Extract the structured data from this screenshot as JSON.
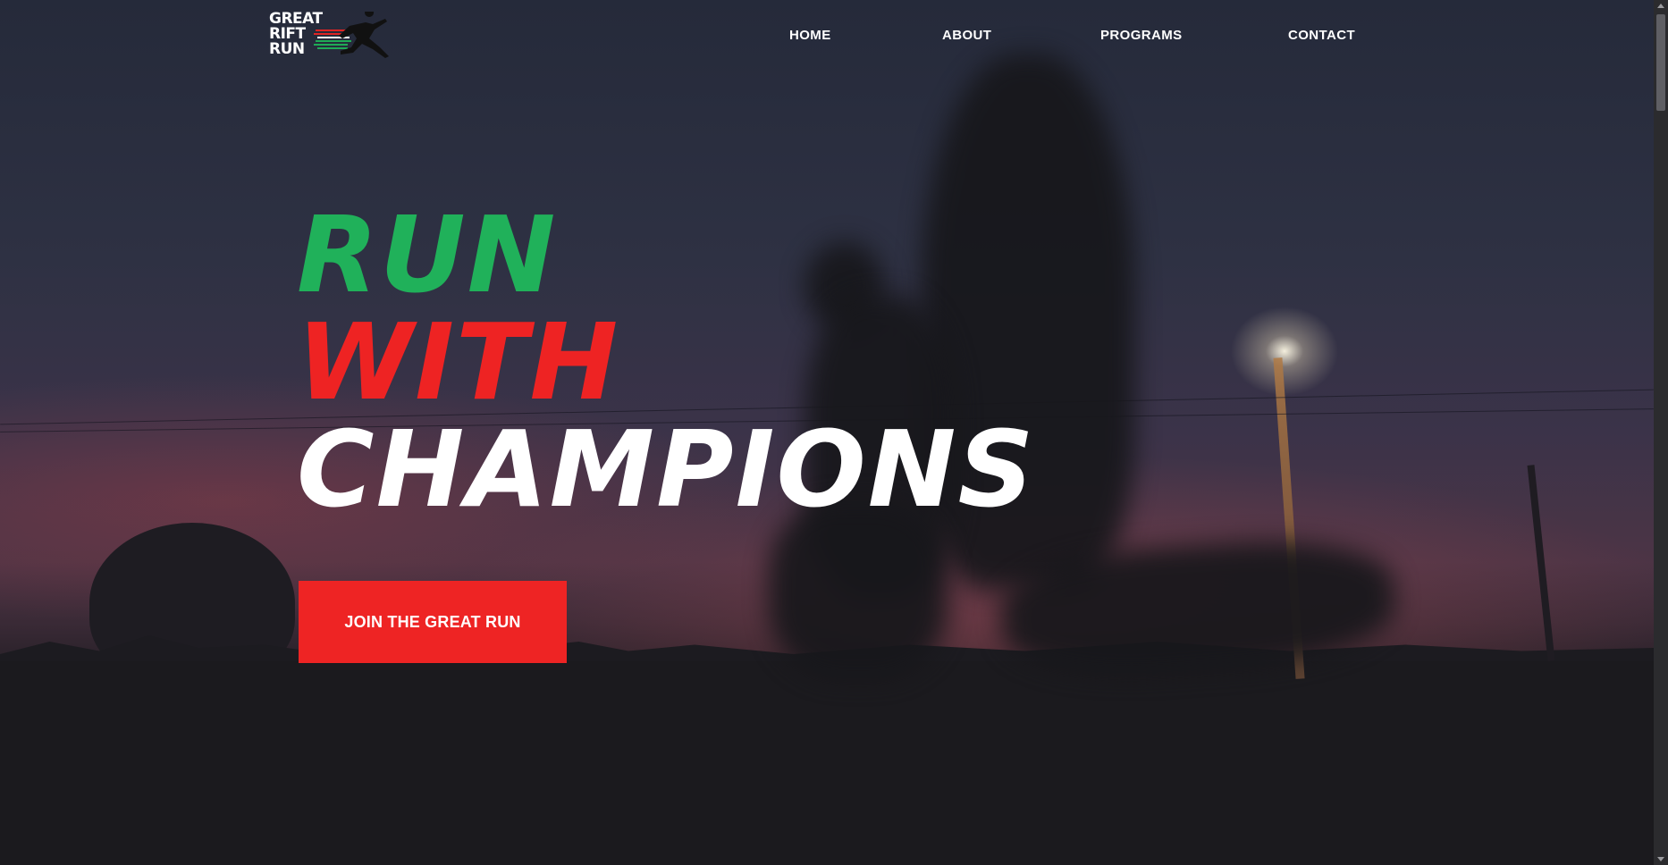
{
  "logo": {
    "lines": [
      "GREAT",
      "RIFT",
      "RUN"
    ],
    "icon": "runner-logo-icon",
    "stripe_colors": [
      "#e02424",
      "#1faa55",
      "#ffffff"
    ]
  },
  "nav": {
    "items": [
      {
        "label": "HOME"
      },
      {
        "label": "ABOUT"
      },
      {
        "label": "PROGRAMS"
      },
      {
        "label": "CONTACT"
      }
    ]
  },
  "hero": {
    "headline": [
      "RUN",
      "WITH",
      "CHAMPIONS"
    ],
    "headline_colors": [
      "#20b15a",
      "#ee2323",
      "#ffffff"
    ],
    "cta_label": "JOIN THE GREAT RUN",
    "cta_color": "#ee2424"
  }
}
